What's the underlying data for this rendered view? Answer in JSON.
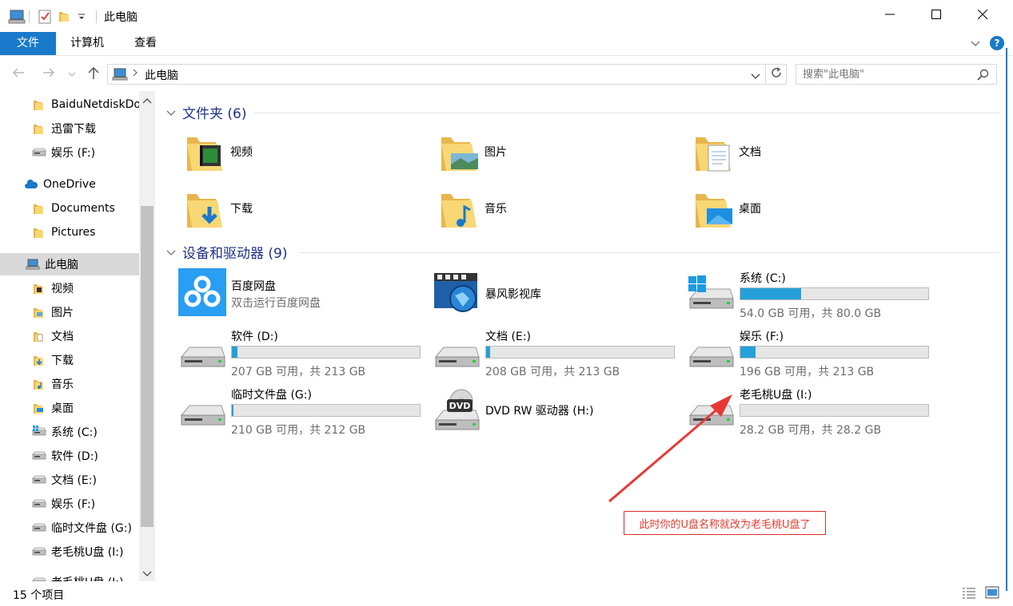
{
  "window": {
    "title": "此电脑",
    "min_icon": "minimize-icon",
    "max_icon": "maximize-icon",
    "close_icon": "close-icon"
  },
  "ribbon": {
    "tabs": [
      {
        "label": "文件",
        "active": true
      },
      {
        "label": "计算机"
      },
      {
        "label": "查看"
      }
    ]
  },
  "address": {
    "path": "此电脑",
    "search_placeholder": "搜索\"此电脑\""
  },
  "nav": {
    "items": [
      {
        "label": "BaiduNetdiskDownload",
        "icon": "folder-icon"
      },
      {
        "label": "迅雷下载",
        "icon": "folder-icon"
      },
      {
        "label": "娱乐 (F:)",
        "icon": "drive-icon"
      },
      {
        "label": "OneDrive",
        "icon": "cloud-icon"
      },
      {
        "label": "Documents",
        "icon": "folder-icon"
      },
      {
        "label": "Pictures",
        "icon": "folder-icon"
      },
      {
        "label": "此电脑",
        "icon": "computer-icon",
        "selected": true
      },
      {
        "label": "视频",
        "icon": "video-folder-icon"
      },
      {
        "label": "图片",
        "icon": "pictures-folder-icon"
      },
      {
        "label": "文档",
        "icon": "documents-folder-icon"
      },
      {
        "label": "下载",
        "icon": "downloads-folder-icon"
      },
      {
        "label": "音乐",
        "icon": "music-folder-icon"
      },
      {
        "label": "桌面",
        "icon": "desktop-folder-icon"
      },
      {
        "label": "系统 (C:)",
        "icon": "windows-drive-icon"
      },
      {
        "label": "软件 (D:)",
        "icon": "drive-icon"
      },
      {
        "label": "文档 (E:)",
        "icon": "drive-icon"
      },
      {
        "label": "娱乐 (F:)",
        "icon": "drive-icon"
      },
      {
        "label": "临时文件盘 (G:)",
        "icon": "drive-icon"
      },
      {
        "label": "老毛桃U盘 (I:)",
        "icon": "drive-icon"
      },
      {
        "label": "老毛桃U盘 (I:)",
        "icon": "drive-icon"
      }
    ]
  },
  "folders_group": {
    "title": "文件夹 (6)",
    "items": [
      {
        "label": "视频",
        "icon": "video-folder-icon"
      },
      {
        "label": "图片",
        "icon": "pictures-folder-icon"
      },
      {
        "label": "文档",
        "icon": "documents-folder-icon"
      },
      {
        "label": "下载",
        "icon": "downloads-folder-icon"
      },
      {
        "label": "音乐",
        "icon": "music-folder-icon"
      },
      {
        "label": "桌面",
        "icon": "desktop-folder-icon"
      }
    ]
  },
  "devices_group": {
    "title": "设备和驱动器 (9)",
    "baidu": {
      "name": "百度网盘",
      "sub": "双击运行百度网盘",
      "icon": "baidu-netdisk-icon"
    },
    "baofeng": {
      "name": "暴风影视库",
      "icon": "baofeng-video-icon"
    },
    "dvd": {
      "name": "DVD RW 驱动器 (H:)",
      "icon": "dvd-drive-icon",
      "dvd_text": "DVD"
    },
    "drives": [
      {
        "name": "系统 (C:)",
        "free": "54.0 GB 可用，共 80.0 GB",
        "used_fraction": 0.325,
        "icon": "windows-drive-icon"
      },
      {
        "name": "软件 (D:)",
        "free": "207 GB 可用，共 213 GB",
        "used_fraction": 0.028,
        "icon": "drive-icon"
      },
      {
        "name": "文档 (E:)",
        "free": "208 GB 可用，共 213 GB",
        "used_fraction": 0.023,
        "icon": "drive-icon"
      },
      {
        "name": "娱乐 (F:)",
        "free": "196 GB 可用，共 213 GB",
        "used_fraction": 0.08,
        "icon": "drive-icon"
      },
      {
        "name": "临时文件盘 (G:)",
        "free": "210 GB 可用，共 212 GB",
        "used_fraction": 0.01,
        "icon": "drive-icon"
      },
      {
        "name": "老毛桃U盘 (I:)",
        "free": "28.2 GB 可用，共 28.2 GB",
        "used_fraction": 0.0,
        "icon": "drive-icon"
      }
    ]
  },
  "status": {
    "count": "15 个项目"
  },
  "annotation": {
    "text": "此时你的U盘名称就改为老毛桃U盘了",
    "color": "#e23b2f"
  },
  "colors": {
    "accent": "#1979ca",
    "bar_fill": "#26a0da",
    "folder": "#f8d775"
  }
}
